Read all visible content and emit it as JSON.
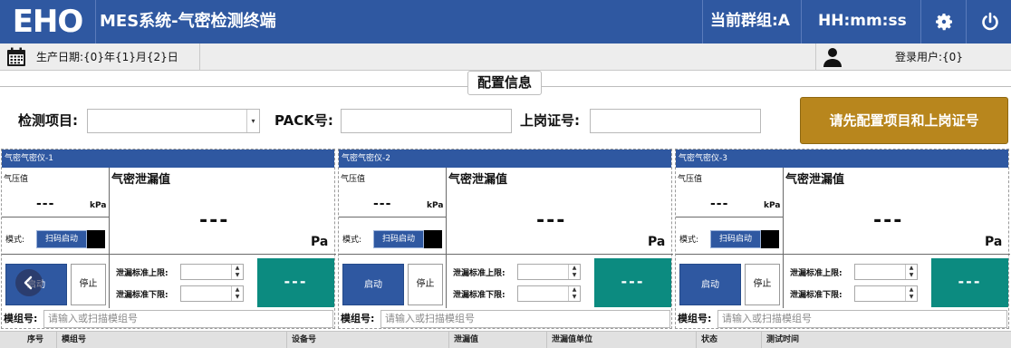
{
  "header": {
    "logo_text": "EHO",
    "title": "MES系统-气密检测终端",
    "group_label": "当前群组:A",
    "clock": "HH:mm:ss",
    "settings_icon": "gear-icon",
    "power_icon": "power-icon"
  },
  "infobar": {
    "production_date": "生产日期:{0}年{1}月{2}日",
    "login_user": "登录用户:{0}"
  },
  "config": {
    "title": "配置信息",
    "project_label": "检测项目:",
    "project_value": "",
    "pack_label": "PACK号:",
    "pack_value": "",
    "cert_label": "上岗证号:",
    "cert_value": "",
    "configure_button": "请先配置项目和上岗证号"
  },
  "panels": [
    {
      "title": "气密气密仪-1",
      "pressure_label": "气压值",
      "pressure_value": "---",
      "pressure_unit": "kPa",
      "leak_label": "气密泄漏值",
      "leak_value": "---",
      "leak_unit": "Pa",
      "mode_label": "模式:",
      "mode_value": "扫码启动",
      "start_label": "启动",
      "stop_label": "停止",
      "upper_label": "泄漏标准上限:",
      "lower_label": "泄漏标准下限:",
      "result": "---",
      "module_label": "模组号:",
      "module_placeholder": "请输入或扫描模组号"
    },
    {
      "title": "气密气密仪-2",
      "pressure_label": "气压值",
      "pressure_value": "---",
      "pressure_unit": "kPa",
      "leak_label": "气密泄漏值",
      "leak_value": "---",
      "leak_unit": "Pa",
      "mode_label": "模式:",
      "mode_value": "扫码启动",
      "start_label": "启动",
      "stop_label": "停止",
      "upper_label": "泄漏标准上限:",
      "lower_label": "泄漏标准下限:",
      "result": "---",
      "module_label": "模组号:",
      "module_placeholder": "请输入或扫描模组号"
    },
    {
      "title": "气密气密仪-3",
      "pressure_label": "气压值",
      "pressure_value": "---",
      "pressure_unit": "kPa",
      "leak_label": "气密泄漏值",
      "leak_value": "---",
      "leak_unit": "Pa",
      "mode_label": "模式:",
      "mode_value": "扫码启动",
      "start_label": "启动",
      "stop_label": "停止",
      "upper_label": "泄漏标准上限:",
      "lower_label": "泄漏标准下限:",
      "result": "---",
      "module_label": "模组号:",
      "module_placeholder": "请输入或扫描模组号"
    }
  ],
  "table": {
    "columns": [
      "序号",
      "模组号",
      "设备号",
      "泄漏值",
      "泄漏值单位",
      "状态",
      "测试时间"
    ]
  },
  "colors": {
    "primary": "#2f58a1",
    "accent_button": "#b8861d",
    "result_teal": "#0c8b80"
  }
}
